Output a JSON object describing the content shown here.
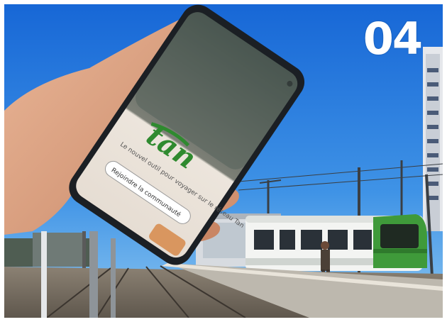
{
  "badge": {
    "text": "04"
  },
  "phone": {
    "brand": "tan",
    "tagline": "Le nouvel outil pour voyager sur le réseau Tan",
    "button": "Rejoindre la communauté"
  },
  "colors": {
    "sky_top": "#1a73d9",
    "sky_bottom": "#6fb7ee",
    "tram_green": "#3f9a3a",
    "phone_screen": "#e9e2da",
    "brand_green": "#2f8a2f"
  }
}
